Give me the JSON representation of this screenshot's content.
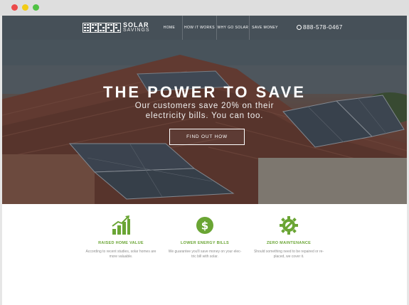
{
  "colors": {
    "accent_green": "#6aa534",
    "chrome_bg": "#dedede",
    "nav_bg": "#4e5862"
  },
  "brand": {
    "name_line1": "SOLAR",
    "name_line2": "SAVINGS",
    "mark_icon": "solar-panel-grid-icon"
  },
  "nav": {
    "items": [
      {
        "label": "HOME"
      },
      {
        "label": "HOW IT WORKS"
      },
      {
        "label": "WHY GO SOLAR"
      },
      {
        "label": "SAVE MONEY"
      }
    ],
    "phone": "888-578-0467",
    "phone_icon": "phone-icon"
  },
  "hero": {
    "headline": "THE POWER TO SAVE",
    "subhead_line1": "Our customers save 20% on their",
    "subhead_line2": "electricity bills. You can too.",
    "cta_label": "FIND OUT HOW"
  },
  "features": [
    {
      "icon": "bar-chart-growth-icon",
      "title": "RAISED HOME VALUE",
      "desc_line1": "According to recent studies, solar homes are",
      "desc_line2": "more valuable."
    },
    {
      "icon": "dollar-circle-icon",
      "title": "LOWER ENERGY BILLS",
      "desc_line1": "We guarantee you'll save money on your elec-",
      "desc_line2": "tric bill with solar."
    },
    {
      "icon": "gear-wrench-icon",
      "title": "ZERO MAINTENANCE",
      "desc_line1": "Should something need to be repaired or re-",
      "desc_line2": "placed, we cover it."
    }
  ]
}
